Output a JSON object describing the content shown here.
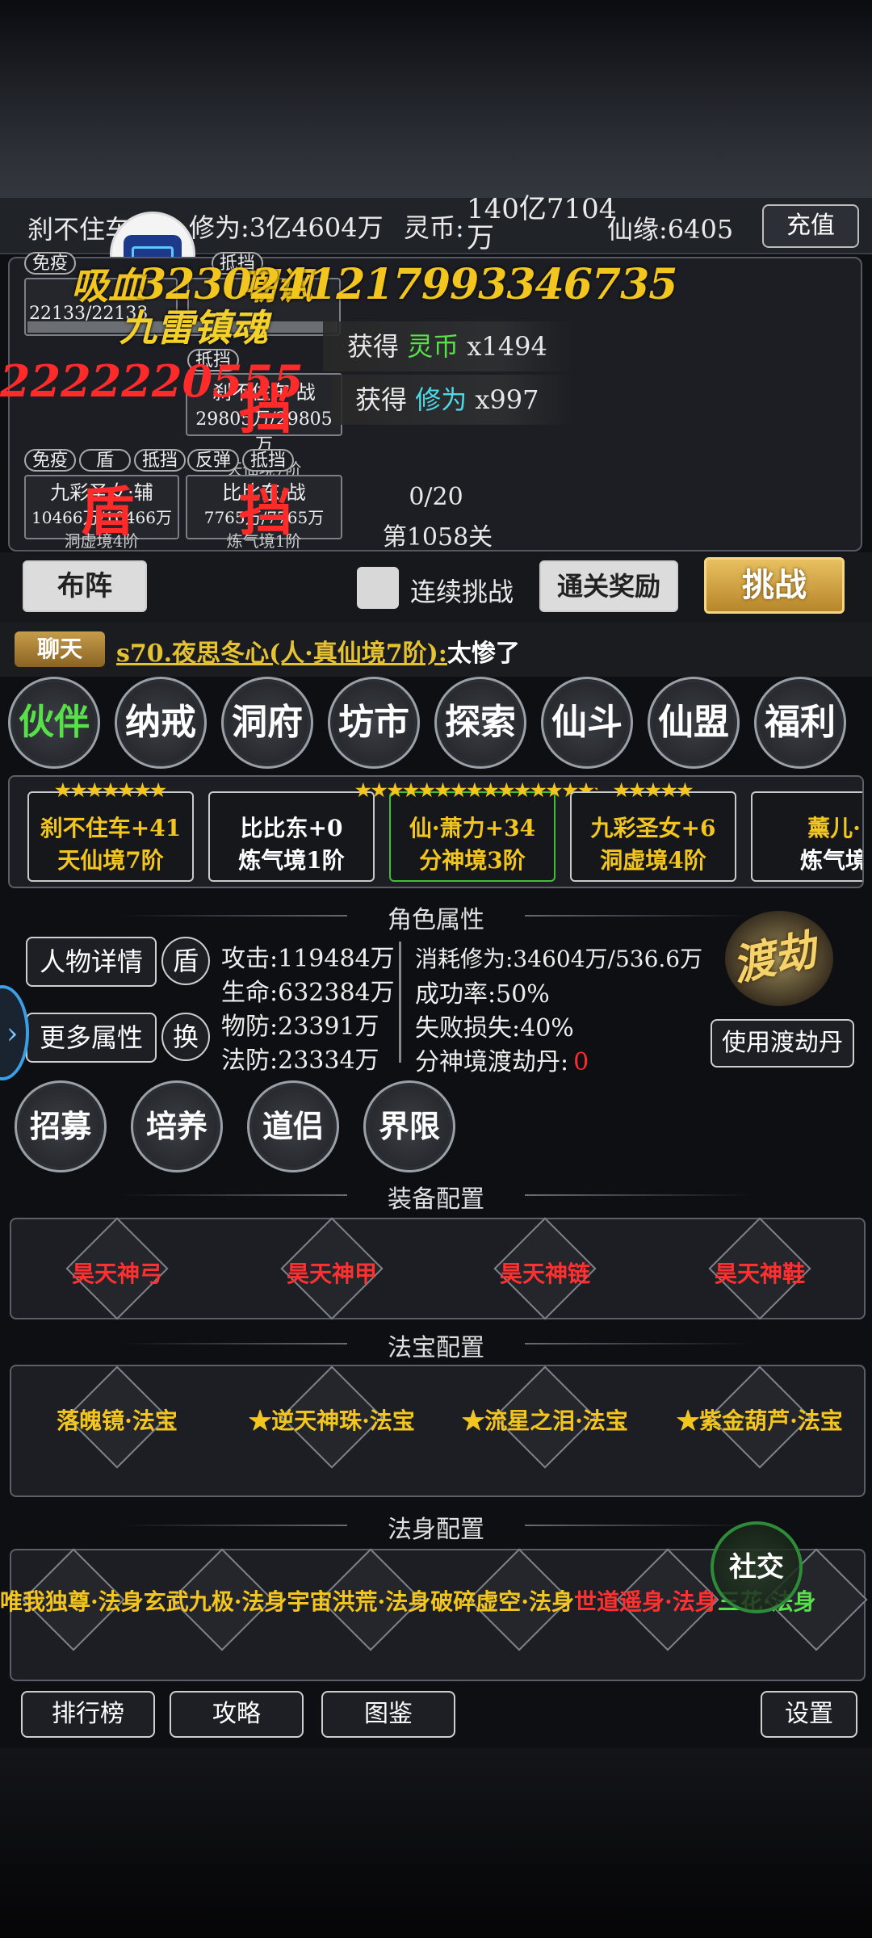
{
  "header": {
    "player_name": "刹不住车",
    "cultivation": "修为:3亿4604万",
    "spirit_coin_label": "灵币:",
    "spirit_coin_value": "140亿7104万",
    "fate": "仙缘:6405",
    "recharge": "充值"
  },
  "battle": {
    "tags_row1": [
      "免疫",
      "抵挡"
    ],
    "tags_row2": [
      "抵挡"
    ],
    "tags_row3": [
      "免疫",
      "盾",
      "抵挡",
      "反弹",
      "抵挡"
    ],
    "unit_a_hp": "22133/22133",
    "unit_b_name": "刹不住车·战",
    "unit_b_hp": "29805万/29805万",
    "unit_b_realm": "天仙境7阶",
    "unit_c_name": "九彩圣女·辅",
    "unit_c_hp": "10466万/10466万",
    "unit_c_realm": "洞虚境4阶",
    "unit_d_name": "比比东·战",
    "unit_d_hp": "7765万/7765万",
    "unit_d_realm": "炼气境1阶",
    "float_skill": "吸血",
    "float_skill2": "嘲讽",
    "float_gold_numbers": "3230241217993346735",
    "float_skill_name": "九雷镇魂",
    "float_red_number": "2222220555",
    "float_dang": "挡",
    "float_dun": "盾",
    "reward1_prefix": "获得",
    "reward1_item": "灵币",
    "reward1_count": "x1494",
    "reward2_prefix": "获得",
    "reward2_item": "修为",
    "reward2_count": "x997",
    "wave": "0/20",
    "stage": "第1058关"
  },
  "controls": {
    "formation": "布阵",
    "auto_label": "连续挑战",
    "clear_reward": "通关奖励",
    "challenge": "挑战"
  },
  "chat": {
    "label": "聊天",
    "speaker": "s70.夜思冬心(人·真仙境7阶):",
    "message": "太惨了"
  },
  "menu": [
    "伙伴",
    "纳戒",
    "洞府",
    "坊市",
    "探索",
    "仙斗",
    "仙盟",
    "福利"
  ],
  "partners": [
    {
      "stars": "★★★★★★★",
      "name": "刹不住车+41",
      "realm": "天仙境7阶"
    },
    {
      "stars": "",
      "name": "比比东+0",
      "realm": "炼气境1阶"
    },
    {
      "stars": "★★★★★★★★★★★★★★★★★★★",
      "name": "仙·萧力+34",
      "realm": "分神境3阶"
    },
    {
      "stars": "★★★★★",
      "name": "九彩圣女+6",
      "realm": "洞虚境4阶"
    },
    {
      "stars": "",
      "name": "薰儿·",
      "realm": "炼气境"
    }
  ],
  "attributes": {
    "title": "角色属性",
    "detail_btn": "人物详情",
    "shield_btn": "盾",
    "more_btn": "更多属性",
    "swap_btn": "换",
    "attack": "攻击:119484万",
    "hp": "生命:632384万",
    "pdef": "物防:23391万",
    "mdef": "法防:23334万",
    "cost": "消耗修为:34604万/536.6万",
    "success": "成功率:50%",
    "fail_loss": "失败损失:40%",
    "pill_label": "分神境渡劫丹:",
    "pill_count": "0",
    "tribulation": "渡劫",
    "use_pill": "使用渡劫丹"
  },
  "actions": [
    "招募",
    "培养",
    "道侣",
    "界限"
  ],
  "equipment": {
    "title": "装备配置",
    "items": [
      "昊天神弓",
      "昊天神甲",
      "昊天神链",
      "昊天神鞋"
    ]
  },
  "treasures": {
    "title": "法宝配置",
    "items": [
      "落魄镜·法宝",
      "★逆天神珠·法宝",
      "★流星之泪·法宝",
      "★紫金葫芦·法宝"
    ]
  },
  "dharma": {
    "title": "法身配置",
    "text_yellow": "唯我独尊·法身玄武九极·法身宇宙洪荒·法身破碎虚空·法身",
    "text_red": "世道遥身·法身",
    "text_green": "三花·法身",
    "social": "社交"
  },
  "bottom": {
    "rank": "排行榜",
    "guide": "攻略",
    "codex": "图鉴",
    "settings": "设置"
  },
  "colors": {
    "gold": "#f3c61f",
    "red": "#ff2a2a",
    "green": "#58e04a",
    "cyan": "#4fd8e8"
  }
}
